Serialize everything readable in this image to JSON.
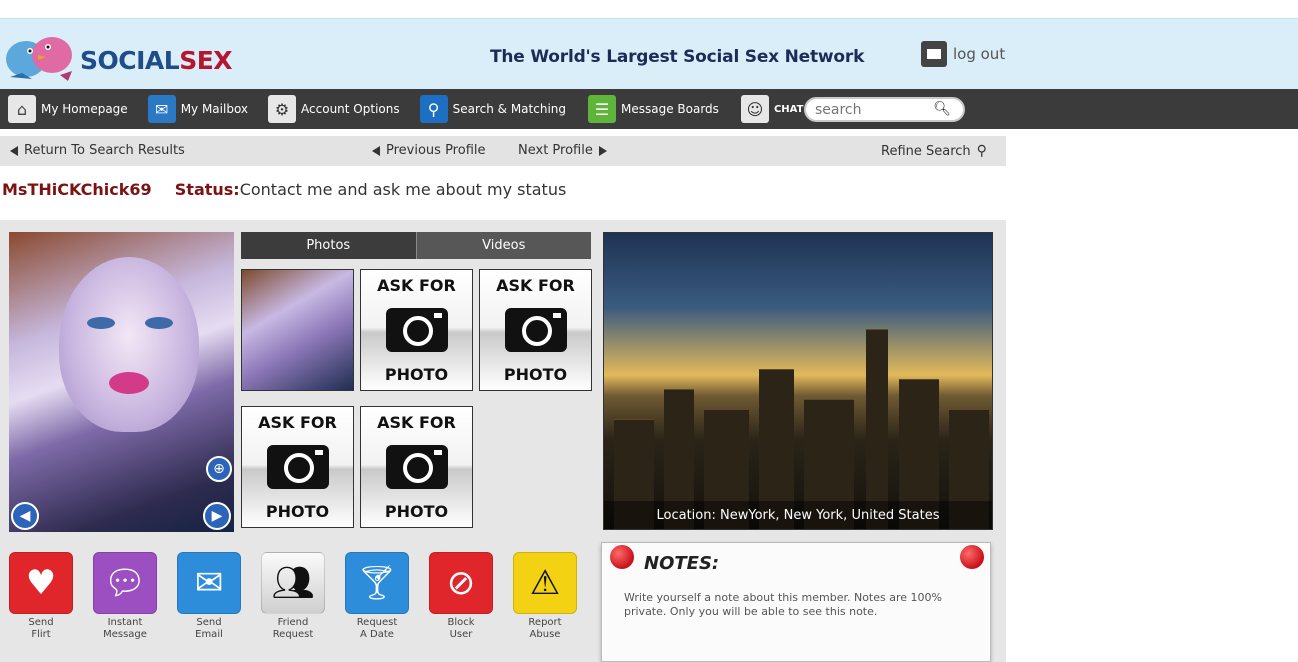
{
  "brand": {
    "part1": "SOCIAL",
    "part2": "SEX"
  },
  "tagline": "The World's Largest Social Sex Network",
  "logout_label": "log out",
  "nav": {
    "items": [
      {
        "label": "My Homepage",
        "icon": "home-icon"
      },
      {
        "label": "My Mailbox",
        "icon": "mailbox-icon"
      },
      {
        "label": "Account Options",
        "icon": "gear-icon"
      },
      {
        "label": "Search & Matching",
        "icon": "search-icon"
      },
      {
        "label": "Message Boards",
        "icon": "board-icon"
      },
      {
        "label": "CHAT ROOMS",
        "icon": "chat-icon"
      }
    ],
    "search_placeholder": "search"
  },
  "subnav": {
    "return": "Return To Search Results",
    "previous": "Previous Profile",
    "next": "Next Profile",
    "refine": "Refine Search"
  },
  "profile": {
    "username": "MsTHiCKChick69",
    "status_label": "Status:",
    "status_text": "Contact me and ask me about my status",
    "location": "Location: NewYork, New York, United States"
  },
  "media_tabs": {
    "photos": "Photos",
    "videos": "Videos"
  },
  "ask_photo": {
    "line1": "ASK FOR",
    "line2": "PHOTO"
  },
  "actions": [
    {
      "label": "Send\nFlirt",
      "icon": "heart-icon"
    },
    {
      "label": "Instant\nMessage",
      "icon": "speech-bubble-icon"
    },
    {
      "label": "Send\nEmail",
      "icon": "envelope-icon"
    },
    {
      "label": "Friend\nRequest",
      "icon": "add-friend-icon"
    },
    {
      "label": "Request\nA Date",
      "icon": "cocktail-icon"
    },
    {
      "label": "Block\nUser",
      "icon": "block-icon"
    },
    {
      "label": "Report\nAbuse",
      "icon": "warning-icon"
    }
  ],
  "notes": {
    "title": "NOTES:",
    "text": "Write yourself a note about this member. Notes are 100% private. Only you will be able to see this note."
  }
}
